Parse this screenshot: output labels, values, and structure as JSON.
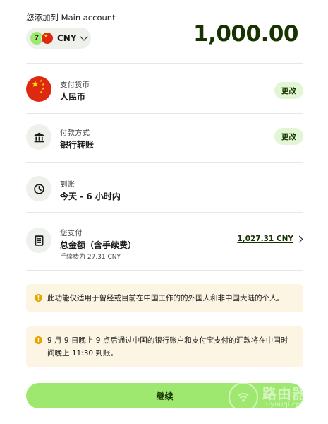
{
  "header": {
    "label": "您添加到 Main account",
    "currency_code": "CNY",
    "amount": "1,000.00",
    "brand_badge": "7"
  },
  "rows": {
    "currency": {
      "sub": "支付货币",
      "main": "人民币",
      "button": "更改",
      "icon": "china-flag"
    },
    "payment": {
      "sub": "付款方式",
      "main": "银行转账",
      "button": "更改",
      "icon": "bank-icon"
    },
    "arrival": {
      "sub": "到账",
      "main": "今天 - 6 小时内",
      "icon": "clock-icon"
    },
    "total": {
      "sub": "您支付",
      "main": "总金额（含手续费）",
      "note": "手续费为 27.31 CNY",
      "value": "1,027.31 CNY",
      "icon": "receipt-icon"
    }
  },
  "alerts": {
    "first": "此功能仅适用于曾经或目前在中国工作的的外国人和非中国大陆的个人。",
    "second": "9 月 9 日晚上 9 点后通过中国的银行账户和支付宝支付的汇款将在中国时间晚上 11:30 到账。"
  },
  "continue_label": "继续",
  "watermark": {
    "title": "路由器",
    "sub": "luyouqi.com"
  },
  "colors": {
    "accent": "#9fe870",
    "dark_green": "#163300",
    "warning_bg": "#fdf5e3",
    "warning_icon": "#e8a500"
  }
}
